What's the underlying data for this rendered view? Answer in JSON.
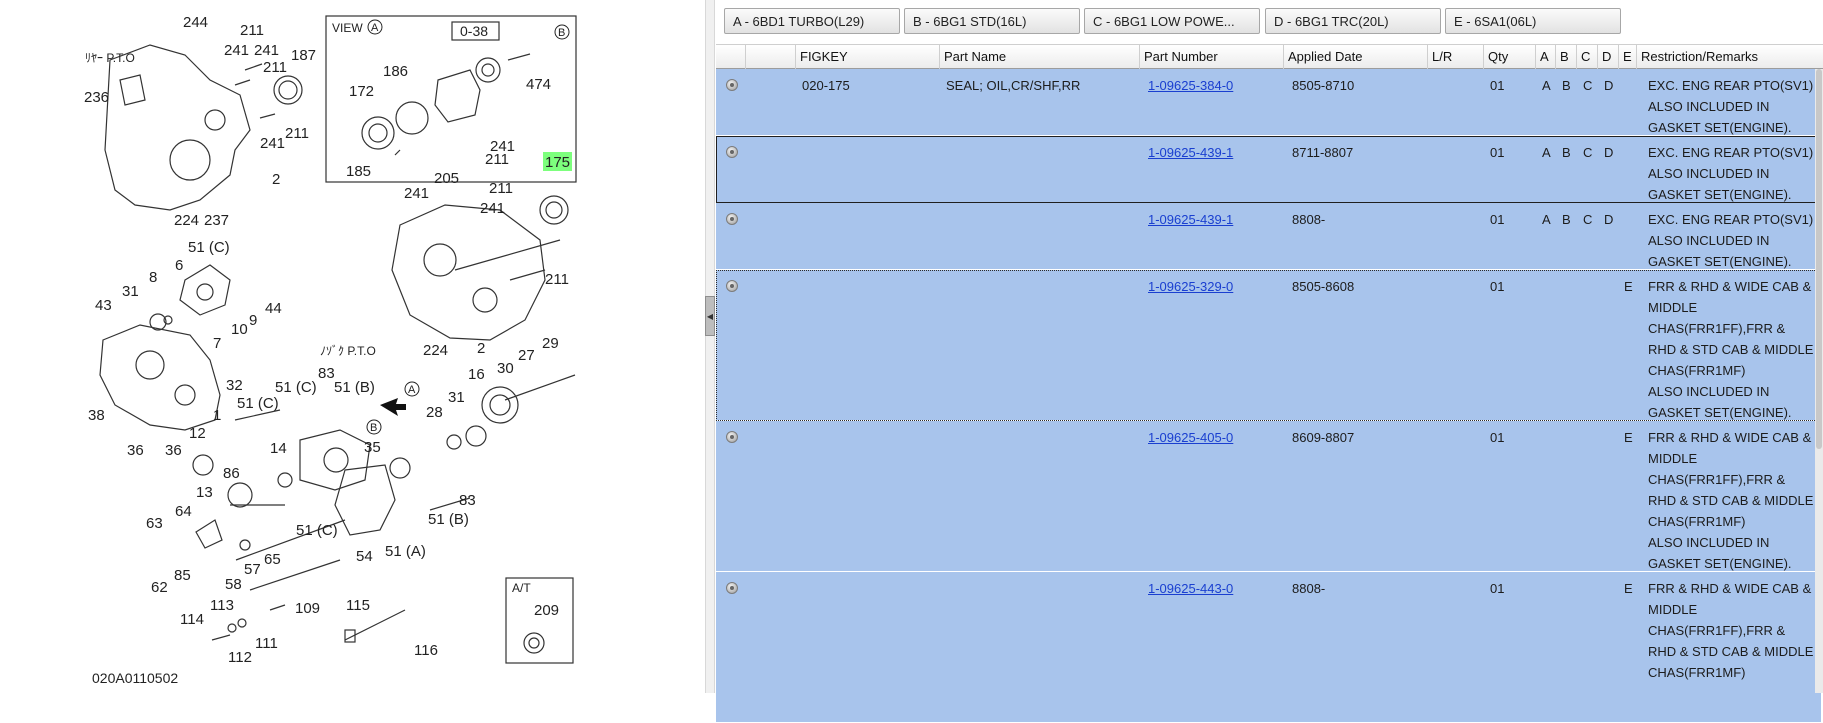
{
  "diagram": {
    "code": "020A0110502",
    "highlight_label": "175",
    "labels": [
      "244",
      "211",
      "241",
      "241",
      "187",
      "211",
      "236",
      "211",
      "241",
      "2",
      "224",
      "237",
      "51 (C)",
      "6",
      "31",
      "8",
      "43",
      "10",
      "9",
      "44",
      "7",
      "32",
      "1",
      "38",
      "36",
      "36",
      "51 (C)",
      "12",
      "14",
      "86",
      "13",
      "63",
      "64",
      "85",
      "62",
      "58",
      "57",
      "65",
      "54",
      "51 (C)",
      "51 (C)",
      "83",
      "51 (B)",
      "35",
      "51 (A)",
      "51 (B)",
      "83",
      "113",
      "114",
      "111",
      "112",
      "109",
      "115",
      "116",
      "16",
      "31",
      "28",
      "30",
      "27",
      "29",
      "211",
      "205",
      "241",
      "211",
      "241",
      "211",
      "241",
      "224",
      "2",
      "186",
      "172",
      "185",
      "474",
      "209"
    ],
    "texts": {
      "rear_pto_top": "ﾘﾔｰ P.T.O",
      "rear_pto_mid": "ﾉｿﾞｸ P.T.O",
      "view_label": "VIEW",
      "view_circle": "A",
      "view_box": "0-38",
      "view_b": "B",
      "at_label": "A/T",
      "arrow_a": "A",
      "arrow_b": "B"
    }
  },
  "engine_tabs": [
    "A - 6BD1 TURBO(L29)",
    "B - 6BG1 STD(16L)",
    "C - 6BG1 LOW POWE...",
    "D - 6BG1 TRC(20L)",
    "E - 6SA1(06L)"
  ],
  "columns": {
    "figkey": "FIGKEY",
    "part_name": "Part Name",
    "part_number": "Part Number",
    "applied_date": "Applied Date",
    "lr": "L/R",
    "qty": "Qty",
    "a": "A",
    "b": "B",
    "c": "C",
    "d": "D",
    "e": "E",
    "remarks": "Restriction/Remarks"
  },
  "rows": [
    {
      "figkey": "020-175",
      "part_name": "SEAL; OIL,CR/SHF,RR",
      "part_number": "1-09625-384-0",
      "applied_date": "8505-8710",
      "lr": "",
      "qty": "01",
      "a": "A",
      "b": "B",
      "c": "C",
      "d": "D",
      "e": "",
      "remarks": [
        "EXC. ENG REAR PTO(SV1)",
        "ALSO INCLUDED IN",
        "GASKET SET(ENGINE)."
      ]
    },
    {
      "figkey": "",
      "part_name": "",
      "part_number": "1-09625-439-1",
      "applied_date": "8711-8807",
      "lr": "",
      "qty": "01",
      "a": "A",
      "b": "B",
      "c": "C",
      "d": "D",
      "e": "",
      "remarks": [
        "EXC. ENG REAR PTO(SV1)",
        "ALSO INCLUDED IN",
        "GASKET SET(ENGINE)."
      ]
    },
    {
      "figkey": "",
      "part_name": "",
      "part_number": "1-09625-439-1",
      "applied_date": "8808-",
      "lr": "",
      "qty": "01",
      "a": "A",
      "b": "B",
      "c": "C",
      "d": "D",
      "e": "",
      "remarks": [
        "EXC. ENG REAR PTO(SV1)",
        "ALSO INCLUDED IN",
        "GASKET SET(ENGINE)."
      ]
    },
    {
      "figkey": "",
      "part_name": "",
      "part_number": "1-09625-329-0",
      "applied_date": "8505-8608",
      "lr": "",
      "qty": "01",
      "a": "",
      "b": "",
      "c": "",
      "d": "",
      "e": "E",
      "remarks": [
        "FRR & RHD & WIDE CAB &",
        "MIDDLE",
        "CHAS(FRR1FF),FRR &",
        "RHD & STD CAB & MIDDLE",
        "CHAS(FRR1MF)",
        "ALSO INCLUDED IN",
        "GASKET SET(ENGINE)."
      ]
    },
    {
      "figkey": "",
      "part_name": "",
      "part_number": "1-09625-405-0",
      "applied_date": "8609-8807",
      "lr": "",
      "qty": "01",
      "a": "",
      "b": "",
      "c": "",
      "d": "",
      "e": "E",
      "remarks": [
        "FRR & RHD & WIDE CAB &",
        "MIDDLE",
        "CHAS(FRR1FF),FRR &",
        "RHD & STD CAB & MIDDLE",
        "CHAS(FRR1MF)",
        "ALSO INCLUDED IN",
        "GASKET SET(ENGINE)."
      ]
    },
    {
      "figkey": "",
      "part_name": "",
      "part_number": "1-09625-443-0",
      "applied_date": "8808-",
      "lr": "",
      "qty": "01",
      "a": "",
      "b": "",
      "c": "",
      "d": "",
      "e": "E",
      "remarks": [
        "FRR & RHD & WIDE CAB &",
        "MIDDLE",
        "CHAS(FRR1FF),FRR &",
        "RHD & STD CAB & MIDDLE",
        "CHAS(FRR1MF)"
      ]
    }
  ],
  "colors": {
    "row_bg": "#a8c4ec",
    "link": "#1a3fd0",
    "highlight": "#7dff7d"
  },
  "icons": {
    "row_expand": "circle-expand-icon",
    "collapse": "left-triangle-icon"
  }
}
